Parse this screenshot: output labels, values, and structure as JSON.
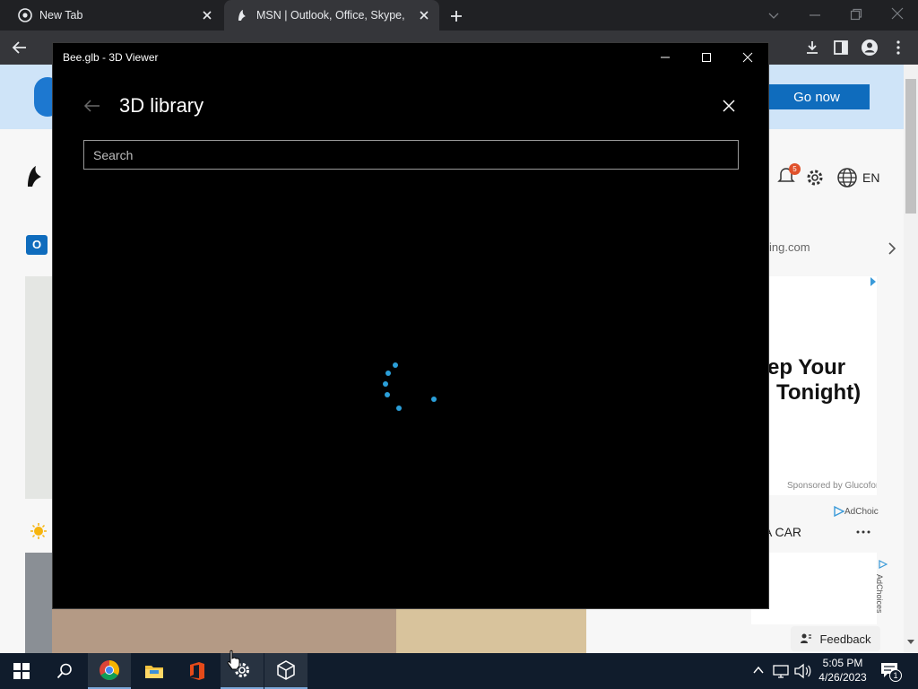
{
  "browser": {
    "tabs": [
      {
        "title": "New Tab",
        "icon": "chrome-icon"
      },
      {
        "title": "MSN | Outlook, Office, Skype, Bing",
        "icon": "msn-icon"
      }
    ]
  },
  "msn_page": {
    "banner_button": "Go now",
    "language": "EN",
    "notification_count": "5",
    "bing_link_fragment": "ing.com",
    "ad_headline_1": "ep Your",
    "ad_headline_2": "Tonight)",
    "sponsored": "Sponsored by Glucofor",
    "adchoices": "AdChoic",
    "section_fragment": "A CAR",
    "feedback": "Feedback",
    "adchoices_vertical": "AdChoices"
  },
  "viewer": {
    "window_title": "Bee.glb - 3D Viewer",
    "library_title": "3D library",
    "search_placeholder": "Search",
    "accent": "#2b9fd9"
  },
  "taskbar": {
    "time": "5:05 PM",
    "date": "4/26/2023",
    "notification_count": "1"
  }
}
